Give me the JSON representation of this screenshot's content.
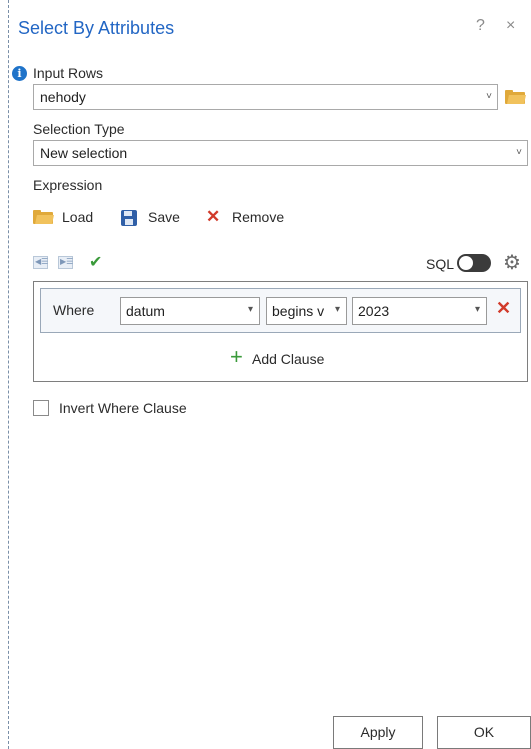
{
  "dialog": {
    "title": "Select By Attributes",
    "help": "?",
    "close": "×"
  },
  "input_rows": {
    "label": "Input Rows",
    "value": "nehody",
    "info_icon": "i"
  },
  "selection_type": {
    "label": "Selection Type",
    "value": "New selection"
  },
  "expression": {
    "label": "Expression",
    "load": "Load",
    "save": "Save",
    "remove": "Remove",
    "sql_label": "SQL"
  },
  "clause": {
    "where": "Where",
    "field": "datum",
    "operator": "begins v",
    "value": "2023",
    "add_clause": "Add Clause"
  },
  "invert": {
    "label": "Invert Where Clause",
    "checked": false
  },
  "footer": {
    "apply": "Apply",
    "ok": "OK"
  },
  "icons": {
    "chevron": "˅",
    "small_chevron": "▾",
    "check": "✔",
    "remove": "✕",
    "gear": "⚙",
    "plus": "+"
  },
  "colors": {
    "title": "#2266c4",
    "remove": "#d13a2a",
    "add": "#3a9a3a",
    "folder": "#e0a93a"
  }
}
